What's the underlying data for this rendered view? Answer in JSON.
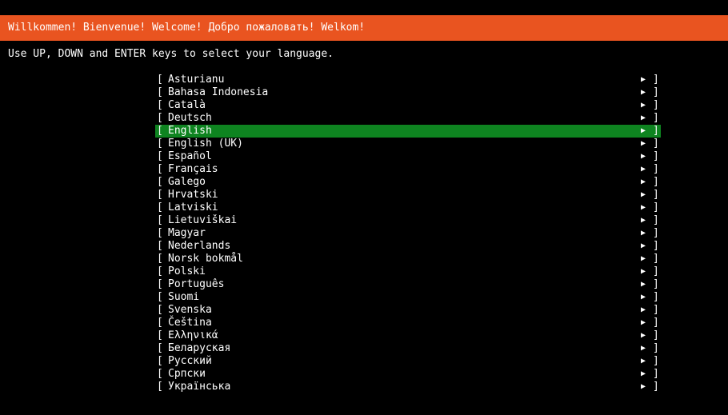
{
  "header": {
    "title": "Willkommen! Bienvenue! Welcome! Добро пожаловать! Welkom!"
  },
  "instructions": "Use UP, DOWN and ENTER keys to select your language.",
  "brackets": {
    "open": "[",
    "close": "]",
    "arrow": "▶"
  },
  "languages": [
    "Asturianu",
    "Bahasa Indonesia",
    "Català",
    "Deutsch",
    "English",
    "English (UK)",
    "Español",
    "Français",
    "Galego",
    "Hrvatski",
    "Latviski",
    "Lietuviškai",
    "Magyar",
    "Nederlands",
    "Norsk bokmål",
    "Polski",
    "Português",
    "Suomi",
    "Svenska",
    "Čeština",
    "Ελληνικά",
    "Беларуская",
    "Русский",
    "Српски",
    "Українська"
  ],
  "selected_language": "English",
  "colors": {
    "header_bg": "#e95420",
    "selected_bg": "#0e8420",
    "background": "#000000",
    "text": "#ffffff"
  }
}
